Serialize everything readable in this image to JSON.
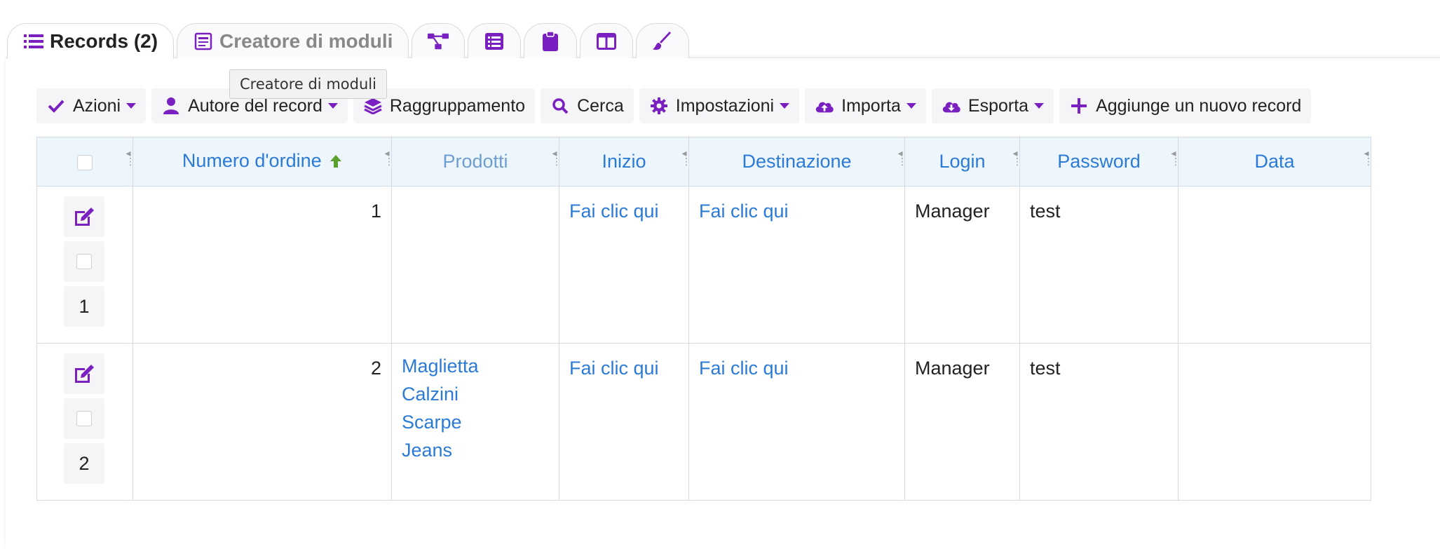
{
  "tabs": [
    {
      "label": "Records (2)",
      "icon": "list-icon",
      "active": true
    },
    {
      "label": "Creatore di moduli",
      "icon": "form-builder-icon",
      "active": false
    },
    {
      "label": "",
      "icon": "workflow-icon"
    },
    {
      "label": "",
      "icon": "list-alt-icon"
    },
    {
      "label": "",
      "icon": "clipboard-icon"
    },
    {
      "label": "",
      "icon": "columns-icon"
    },
    {
      "label": "",
      "icon": "brush-icon"
    }
  ],
  "tooltip": "Creatore di moduli",
  "toolbar": {
    "actions": "Azioni",
    "author": "Autore del record",
    "grouping": "Raggruppamento",
    "search": "Cerca",
    "settings": "Impostazioni",
    "import": "Importa",
    "export": "Esporta",
    "add": "Aggiunge un nuovo record"
  },
  "table": {
    "columns": [
      "Numero d'ordine",
      "Prodotti",
      "Inizio",
      "Destinazione",
      "Login",
      "Password",
      "Data"
    ],
    "rows": [
      {
        "index": "1",
        "order": "1",
        "products": [],
        "start": "Fai clic qui",
        "destination": "Fai clic qui",
        "login": "Manager",
        "password": "test",
        "date": ""
      },
      {
        "index": "2",
        "order": "2",
        "products": [
          "Maglietta",
          "Calzini",
          "Scarpe",
          "Jeans"
        ],
        "start": "Fai clic qui",
        "destination": "Fai clic qui",
        "login": "Manager",
        "password": "test",
        "date": ""
      }
    ]
  },
  "colors": {
    "accent": "#7a1fc0",
    "link": "#2b7bd6",
    "header_bg": "#eef6fd",
    "sort_arrow": "#5aa02c"
  }
}
